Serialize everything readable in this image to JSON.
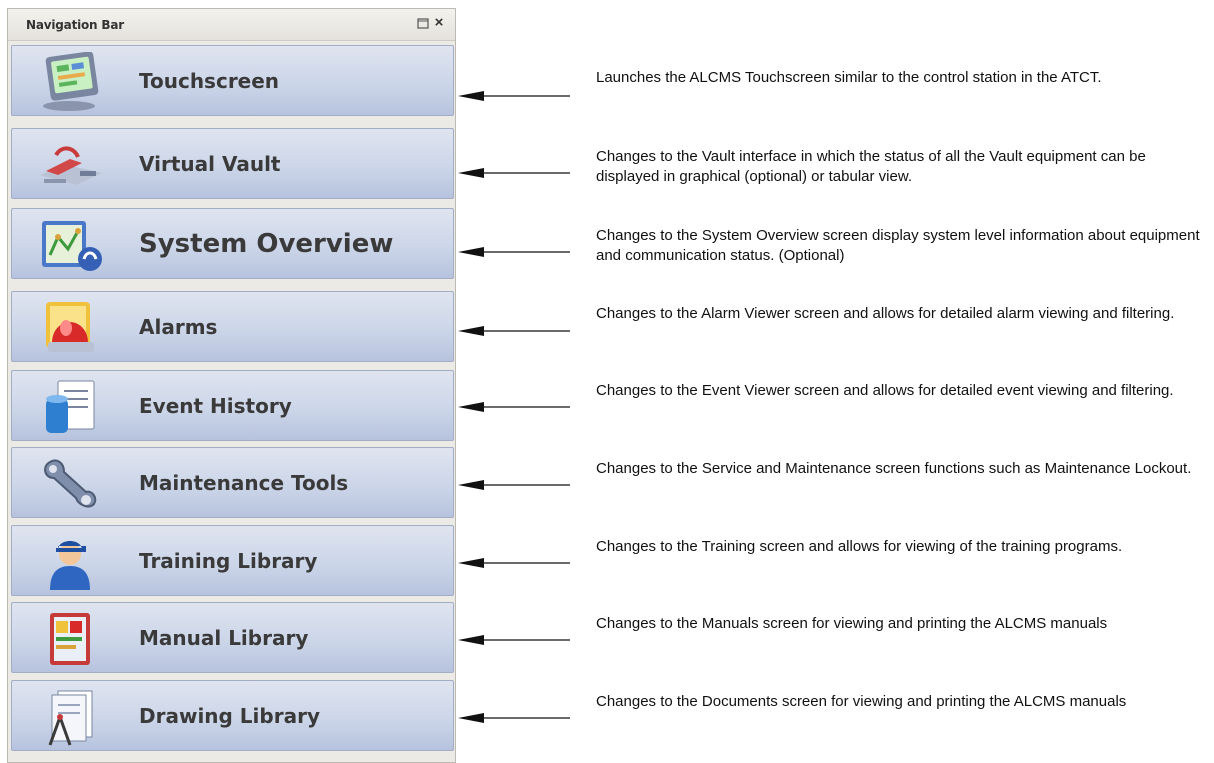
{
  "panel": {
    "title": "Navigation Bar",
    "restore_icon": "restore-icon",
    "close_icon": "close-icon",
    "close_glyph": "×"
  },
  "items": [
    {
      "label": "Touchscreen",
      "icon": "touchscreen-monitor-icon",
      "description": "Launches the ALCMS Touchscreen similar to the control station in the ATCT."
    },
    {
      "label": "Virtual Vault",
      "icon": "virtual-vault-icon",
      "description": "Changes to the Vault interface in which the status of all the Vault equipment can be displayed in graphical (optional) or tabular view."
    },
    {
      "label": "System Overview",
      "icon": "system-overview-icon",
      "description": "Changes to the System Overview screen display system level information about equipment and communication status. (Optional)"
    },
    {
      "label": "Alarms",
      "icon": "alarm-light-icon",
      "description": "Changes to the Alarm Viewer screen and allows for detailed alarm viewing and filtering."
    },
    {
      "label": "Event History",
      "icon": "event-history-icon",
      "description": "Changes to the Event Viewer screen and allows for detailed event viewing and filtering."
    },
    {
      "label": "Maintenance Tools",
      "icon": "wrench-icon",
      "description": "Changes to the Service and Maintenance screen functions such as Maintenance Lockout."
    },
    {
      "label": "Training Library",
      "icon": "trainee-person-icon",
      "description": "Changes to the Training screen and allows for viewing of the training programs."
    },
    {
      "label": "Manual Library",
      "icon": "manual-book-icon",
      "description": "Changes to the Manuals screen for viewing and printing the ALCMS manuals"
    },
    {
      "label": "Drawing Library",
      "icon": "drawing-compass-icon",
      "description": "Changes to the Documents screen for viewing and printing the ALCMS manuals"
    }
  ]
}
